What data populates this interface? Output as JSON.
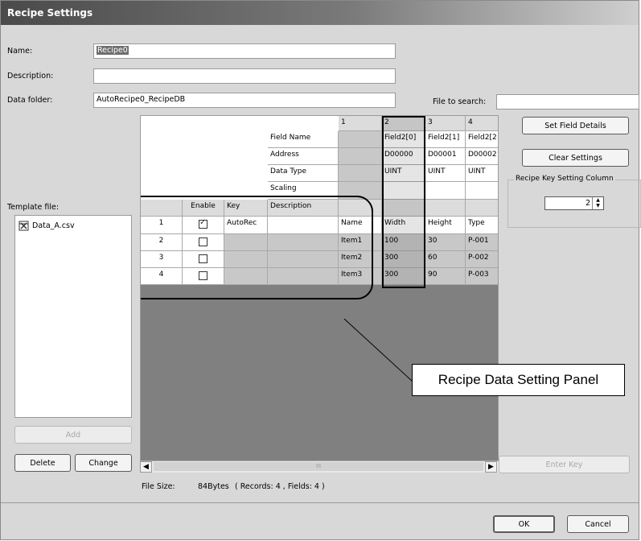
{
  "window": {
    "title": "Recipe Settings"
  },
  "form": {
    "name_label": "Name:",
    "name_value": "Recipe0",
    "description_label": "Description:",
    "description_value": "",
    "data_folder_label": "Data folder:",
    "data_folder_value": "AutoRecipe0_RecipeDB",
    "file_search_label": "File to search:",
    "file_search_value": ""
  },
  "template": {
    "label": "Template file:",
    "files": [
      "Data_A.csv"
    ],
    "add_button": "Add",
    "delete_button": "Delete",
    "change_button": "Change"
  },
  "grid": {
    "column_numbers": [
      "1",
      "2",
      "3",
      "4"
    ],
    "field_row_labels": [
      "Field Name",
      "Address",
      "Data Type",
      "Scaling"
    ],
    "field_names": [
      "",
      "Field2[0]",
      "Field2[1]",
      "Field2[2"
    ],
    "addresses": [
      "",
      "D00000",
      "D00001",
      "D00002"
    ],
    "data_types": [
      "",
      "UINT",
      "UINT",
      "UINT"
    ],
    "record_headers": [
      "Enable",
      "Key",
      "Description"
    ],
    "record_column_headers": [
      "Name",
      "Width",
      "Height",
      "Type"
    ],
    "rows": [
      {
        "num": "1",
        "enabled": true,
        "key": "AutoRec",
        "description": "",
        "values": [
          "Name",
          "Width",
          "Height",
          "Type"
        ]
      },
      {
        "num": "2",
        "enabled": false,
        "key": "",
        "description": "",
        "values": [
          "Item1",
          "100",
          "30",
          "P-001"
        ]
      },
      {
        "num": "3",
        "enabled": false,
        "key": "",
        "description": "",
        "values": [
          "Item2",
          "300",
          "60",
          "P-002"
        ]
      },
      {
        "num": "4",
        "enabled": false,
        "key": "",
        "description": "",
        "values": [
          "Item3",
          "300",
          "90",
          "P-003"
        ]
      }
    ],
    "scroll_thumb_label": "III"
  },
  "side": {
    "set_field_details": "Set Field Details",
    "clear_settings": "Clear Settings",
    "key_column_label": "Recipe Key Setting Column",
    "key_column_value": "2",
    "enter_key": "Enter Key"
  },
  "status": {
    "file_size_label": "File Size:",
    "file_size_value": "84Bytes",
    "records_info": "( Records: 4 , Fields: 4 )"
  },
  "footer": {
    "ok": "OK",
    "cancel": "Cancel"
  },
  "annotation": {
    "callout": "Recipe Data Setting Panel"
  }
}
